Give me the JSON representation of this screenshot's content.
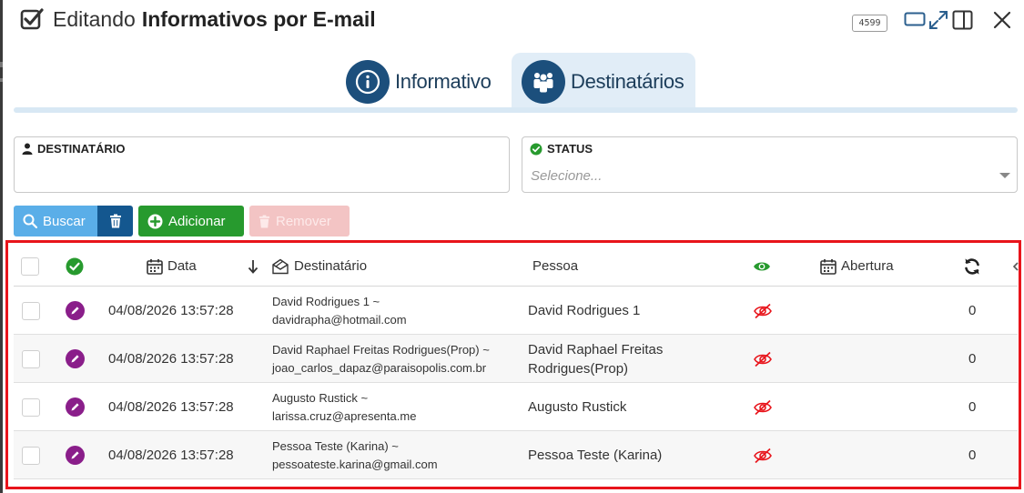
{
  "header": {
    "title_prefix": "Editando",
    "title_main": "Informativos por E-mail",
    "badge": "4599"
  },
  "tabs": [
    {
      "label": "Informativo",
      "icon": "info-icon",
      "active": false
    },
    {
      "label": "Destinatários",
      "icon": "users-group-icon",
      "active": true
    }
  ],
  "filters": {
    "destinatario_label": "DESTINATÁRIO",
    "status_label": "STATUS",
    "status_placeholder": "Selecione..."
  },
  "buttons": {
    "buscar": "Buscar",
    "adicionar": "Adicionar",
    "remover": "Remover"
  },
  "table": {
    "columns": {
      "data": "Data",
      "destinatario": "Destinatário",
      "pessoa": "Pessoa",
      "abertura": "Abertura"
    },
    "rows": [
      {
        "data": "04/08/2026 13:57:28",
        "dest_line1": "David Rodrigues 1 ~",
        "dest_line2": "davidrapha@hotmail.com",
        "pessoa_line1": "David Rodrigues 1",
        "pessoa_line2": "",
        "count": "0"
      },
      {
        "data": "04/08/2026 13:57:28",
        "dest_line1": "David Raphael Freitas Rodrigues(Prop) ~",
        "dest_line2": "joao_carlos_dapaz@paraisopolis.com.br",
        "pessoa_line1": "David Raphael Freitas",
        "pessoa_line2": "Rodrigues(Prop)",
        "count": "0"
      },
      {
        "data": "04/08/2026 13:57:28",
        "dest_line1": "Augusto Rustick ~",
        "dest_line2": "larissa.cruz@apresenta.me",
        "pessoa_line1": "Augusto Rustick",
        "pessoa_line2": "",
        "count": "0"
      },
      {
        "data": "04/08/2026 13:57:28",
        "dest_line1": "Pessoa Teste (Karina) ~",
        "dest_line2": "pessoateste.karina@gmail.com",
        "pessoa_line1": "Pessoa Teste (Karina)",
        "pessoa_line2": "",
        "count": "0"
      }
    ]
  },
  "colors": {
    "tab_circle": "#1c4f7c",
    "buscar": "#5aaee8",
    "trash": "#14578f",
    "adicionar": "#279a2e",
    "remover": "#f3c4c4",
    "edit": "#8a1e8a",
    "not_viewed": "#e8141b",
    "highlight_frame": "#e8141b"
  }
}
